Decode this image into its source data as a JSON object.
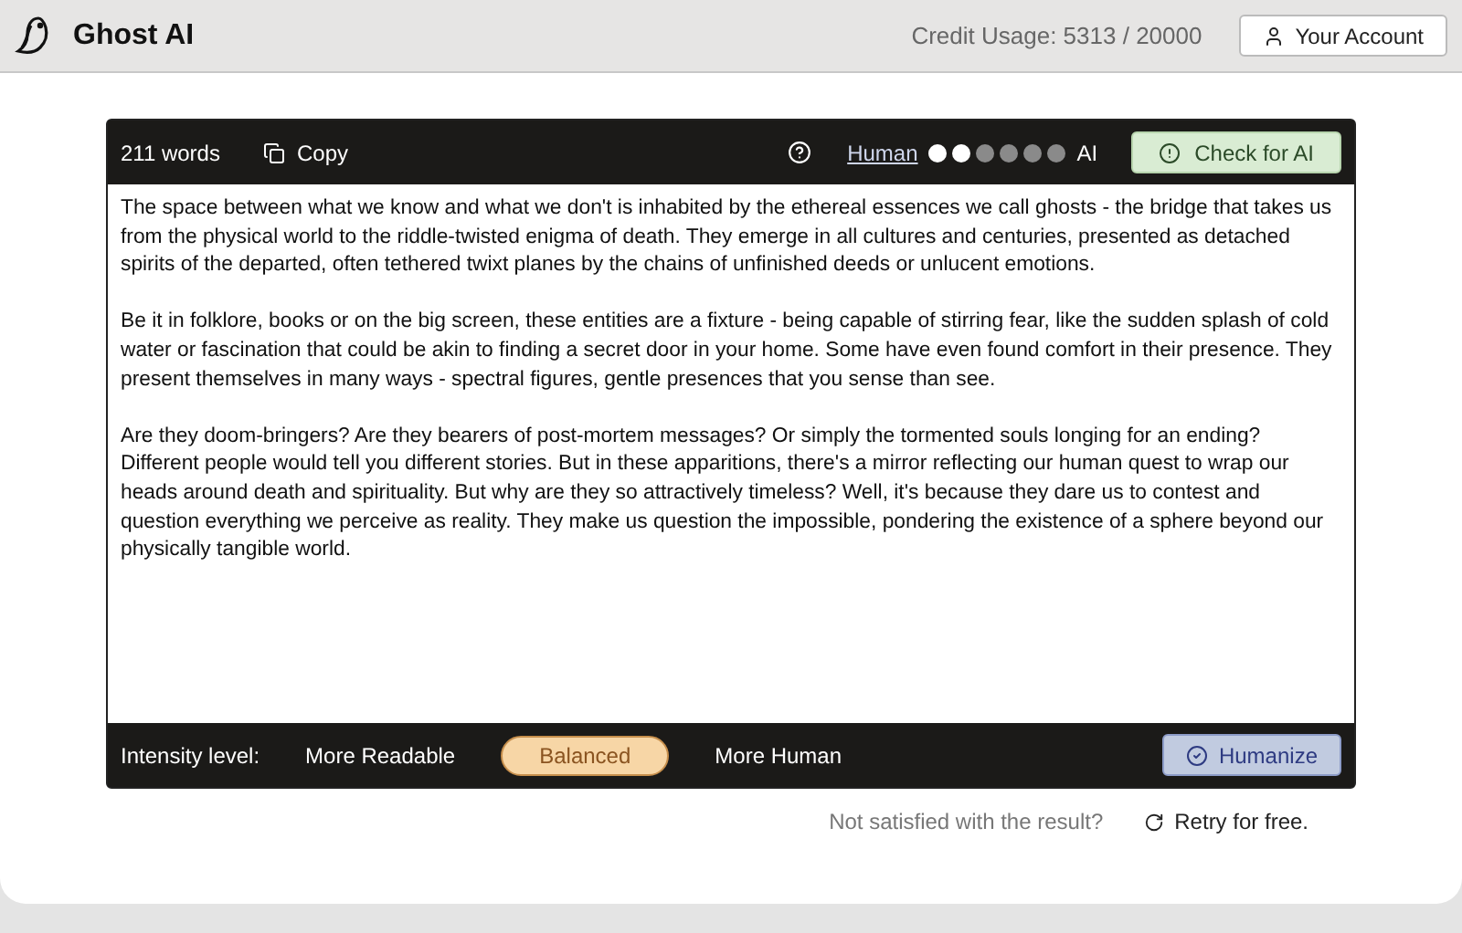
{
  "header": {
    "brand": "Ghost AI",
    "credit_usage": "Credit Usage: 5313 / 20000",
    "account_button": "Your Account"
  },
  "toolbar": {
    "word_count": "211 words",
    "copy_button": "Copy",
    "scale_left": "Human",
    "scale_right": "AI",
    "dots": [
      {
        "filled": true
      },
      {
        "filled": true
      },
      {
        "filled": false
      },
      {
        "filled": false
      },
      {
        "filled": false
      },
      {
        "filled": false
      }
    ],
    "check_button": "Check for AI"
  },
  "paragraphs": [
    "The space between what we know and what we don't is inhabited by the ethereal essences we call ghosts - the bridge that takes us from the physical world to the riddle-twisted enigma of death. They emerge in all cultures and centuries, presented as detached spirits of the departed, often tethered twixt planes by the chains of unfinished deeds or unlucent emotions.",
    "Be it in folklore, books or on the big screen, these entities are a fixture - being capable of stirring fear, like the sudden splash of cold water or fascination that could be akin to finding a secret door in your home. Some have even found comfort in their presence. They present themselves in many ways - spectral figures, gentle presences that you sense than see.",
    "Are they doom-bringers? Are they bearers of post-mortem messages? Or simply the tormented souls longing for an ending? Different people would tell you different stories. But in these apparitions, there's a mirror reflecting our human quest to wrap our heads around death and spirituality. But why are they so attractively timeless? Well, it's because they dare us to contest and question everything we perceive as reality. They make us question the impossible, pondering the existence of a sphere beyond our physically tangible world."
  ],
  "intensity": {
    "label": "Intensity level:",
    "options": [
      {
        "label": "More Readable",
        "selected": false
      },
      {
        "label": "Balanced",
        "selected": true
      },
      {
        "label": "More Human",
        "selected": false
      }
    ]
  },
  "humanize_button": "Humanize",
  "footer": {
    "question": "Not satisfied with the result?",
    "retry": "Retry for free."
  }
}
